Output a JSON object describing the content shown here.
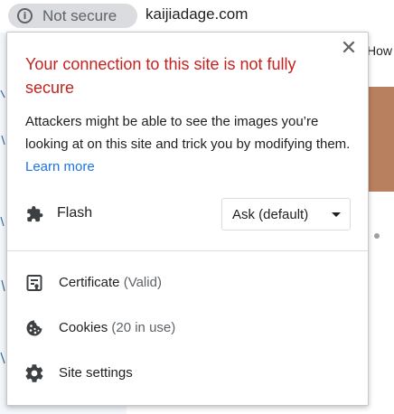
{
  "address_bar": {
    "security_chip_label": "Not secure",
    "domain": "kaijiadage.com"
  },
  "background_page": {
    "right_text": "How"
  },
  "popup": {
    "title": "Your connection to this site is not fully secure",
    "description": "Attackers might be able to see the images you’re looking at on this site and trick you by modifying them.",
    "learn_more": "Learn more",
    "close_symbol": "✕",
    "permission": {
      "label": "Flash",
      "icon": "puzzle-icon",
      "selected_option": "Ask (default)"
    },
    "menu": [
      {
        "label": "Certificate",
        "sub": "(Valid)",
        "icon": "certificate-icon"
      },
      {
        "label": "Cookies",
        "sub": "(20 in use)",
        "icon": "cookie-icon"
      },
      {
        "label": "Site settings",
        "sub": "",
        "icon": "gear-icon"
      }
    ]
  },
  "colors": {
    "warning_title": "#c5221f",
    "link": "#1a73e8",
    "chip_background": "#dadce0",
    "icon": "#5f6368"
  }
}
